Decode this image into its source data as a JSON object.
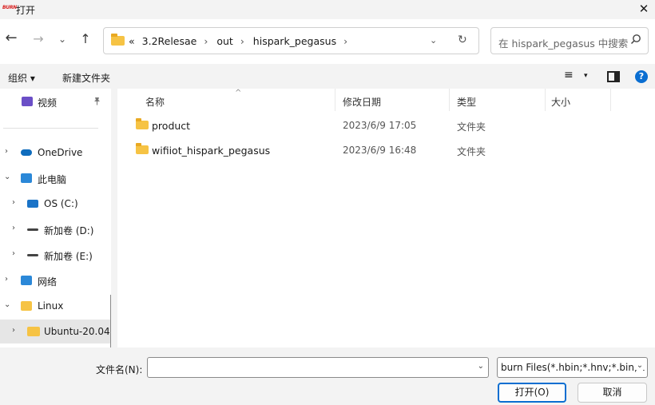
{
  "window": {
    "app_icon_text": "BURN",
    "title": "打开",
    "close_glyph": "✕"
  },
  "nav": {
    "back_glyph": "←",
    "forward_glyph": "→",
    "recent_glyph": "⌄",
    "up_glyph": "↑",
    "breadcrumb": {
      "overflow": "«",
      "items": [
        "3.2Relesae",
        "out",
        "hispark_pegasus"
      ],
      "separator": "›"
    },
    "address_dropdown_glyph": "⌄",
    "refresh_glyph": "↻",
    "search_placeholder": "在 hispark_pegasus 中搜索"
  },
  "command_bar": {
    "organize_label": "组织 ▾",
    "new_folder_label": "新建文件夹",
    "view_glyph": "≡",
    "view_dropdown_glyph": "▾",
    "help_glyph": "?"
  },
  "sidebar": {
    "items": [
      {
        "label": "视频",
        "icon": "video-icon",
        "color": "#6b4fc7"
      },
      {
        "label": "OneDrive",
        "icon": "cloud-icon",
        "color": "#0f6cbd"
      },
      {
        "label": "此电脑",
        "icon": "computer-icon",
        "color": "#2b88d8"
      },
      {
        "label": "OS (C:)",
        "icon": "windows-drive-icon",
        "color": "#1a73c7"
      },
      {
        "label": "新加卷 (D:)",
        "icon": "drive-icon",
        "color": "#444444"
      },
      {
        "label": "新加卷 (E:)",
        "icon": "drive-icon",
        "color": "#444444"
      },
      {
        "label": "网络",
        "icon": "network-icon",
        "color": "#2b88d8"
      },
      {
        "label": "Linux",
        "icon": "folder-icon",
        "color": "#f6c344"
      },
      {
        "label": "Ubuntu-20.04",
        "icon": "folder-icon",
        "color": "#f6c344"
      }
    ],
    "pin_glyph": "📌",
    "chevron_right": "›",
    "chevron_down": "⌄"
  },
  "file_list": {
    "columns": [
      "名称",
      "修改日期",
      "类型",
      "大小"
    ],
    "sort_caret": "^",
    "rows": [
      {
        "name": "product",
        "modified": "2023/6/9 17:05",
        "type": "文件夹",
        "size": ""
      },
      {
        "name": "wifiiot_hispark_pegasus",
        "modified": "2023/6/9 16:48",
        "type": "文件夹",
        "size": ""
      }
    ]
  },
  "footer": {
    "filename_label": "文件名(N):",
    "filename_value": "",
    "dropdown_glyph": "⌄",
    "filter_text": "burn Files(*.hbin;*.hnv;*.bin;*.",
    "open_label": "打开(O)",
    "cancel_label": "取消"
  },
  "colors": {
    "accent": "#0a6ed1",
    "folder": "#f6c344",
    "window_bg": "#f3f3f3",
    "pane_bg": "#ffffff"
  }
}
